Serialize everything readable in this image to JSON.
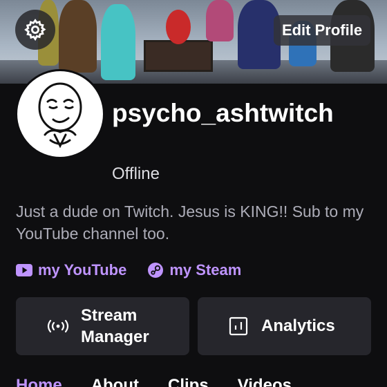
{
  "header": {
    "edit_profile_label": "Edit Profile",
    "settings_icon": "gear-icon"
  },
  "profile": {
    "username": "psycho_ashtwitch",
    "status": "Offline",
    "bio": "Just a dude on Twitch. Jesus is KING!! Sub to my YouTube channel too.",
    "avatar_icon": "trollface-avatar"
  },
  "links": [
    {
      "label": "my YouTube",
      "icon": "youtube-icon"
    },
    {
      "label": "my Steam",
      "icon": "steam-icon"
    }
  ],
  "actions": {
    "stream_manager_label": "Stream Manager",
    "analytics_label": "Analytics"
  },
  "tabs": [
    "Home",
    "About",
    "Clips",
    "Videos"
  ],
  "colors": {
    "accent": "#bf94ff",
    "background": "#0e0e10",
    "button_bg": "#26262c",
    "text_muted": "#adadb8"
  }
}
